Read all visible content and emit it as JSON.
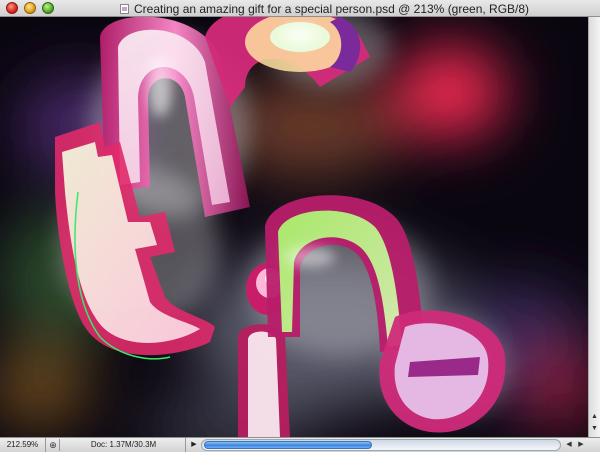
{
  "window": {
    "title": "Creating an amazing gift for a special person.psd @ 213% (green, RGB/8)"
  },
  "icons": {
    "close": "close-button",
    "minimize": "minimize-button",
    "zoom": "zoom-button",
    "document": "document-icon",
    "status_info": "info-icon",
    "status_menu": "play-arrow-icon",
    "scroll_left": "arrow-left-icon",
    "scroll_right": "arrow-right-icon",
    "scroll_up": "arrow-up-icon",
    "scroll_down": "arrow-down-icon"
  },
  "status": {
    "zoom_level": "212.59%",
    "doc_info": "Doc: 1.37M/30.3M"
  },
  "scroll": {
    "horizontal_position": 0.47
  },
  "colors": {
    "titlebar": "#dcdcdc",
    "scroll_thumb": "#3a86e2"
  }
}
